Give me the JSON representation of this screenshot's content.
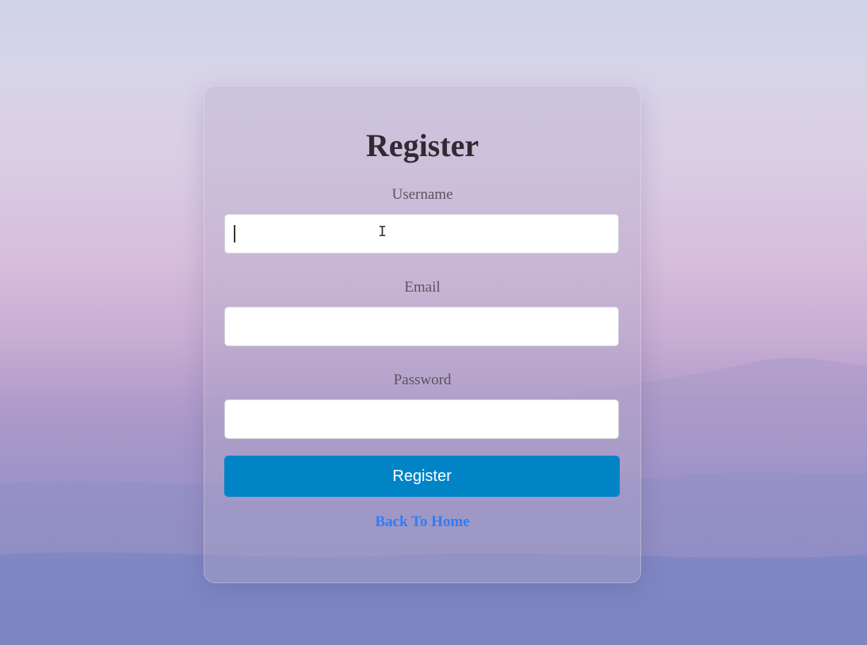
{
  "form": {
    "title": "Register",
    "fields": [
      {
        "label": "Username",
        "value": "",
        "placeholder": "",
        "type": "text"
      },
      {
        "label": "Email",
        "value": "",
        "placeholder": "",
        "type": "email"
      },
      {
        "label": "Password",
        "value": "",
        "placeholder": "",
        "type": "password"
      }
    ],
    "submit_label": "Register",
    "back_link": "Back To Home"
  },
  "colors": {
    "button": "#0084c6",
    "link": "#2f7cf6",
    "title": "#2f2a33"
  },
  "icons": {
    "text_cursor": "text-cursor-icon"
  }
}
